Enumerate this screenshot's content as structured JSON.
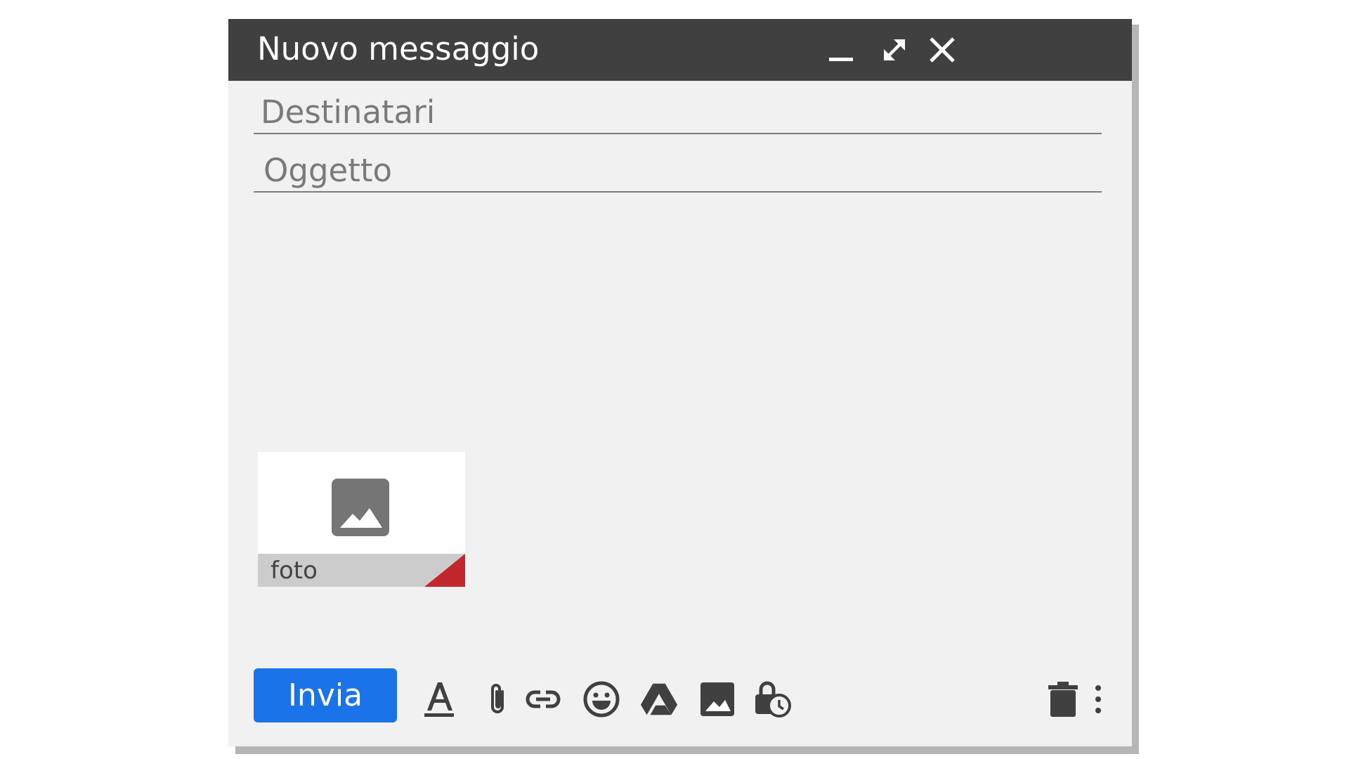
{
  "compose": {
    "title": "Nuovo messaggio",
    "recipients_placeholder": "Destinatari",
    "subject_placeholder": "Oggetto",
    "attachment": {
      "name": "foto",
      "icon": "image-icon"
    },
    "send_label": "Invia"
  },
  "titlebar_controls": [
    "minimize-icon",
    "expand-icon",
    "close-icon"
  ],
  "toolbar_icons": [
    "formatting-icon",
    "attach-file-icon",
    "insert-link-icon",
    "emoji-icon",
    "google-drive-icon",
    "insert-photo-icon",
    "confidential-mode-icon",
    "delete-icon",
    "more-options-icon"
  ],
  "colors": {
    "titlebar": "#404040",
    "window_bg": "#f1f1f1",
    "send_button": "#1a73e8",
    "icon": "#404040",
    "attachment_corner": "#c1272d"
  }
}
